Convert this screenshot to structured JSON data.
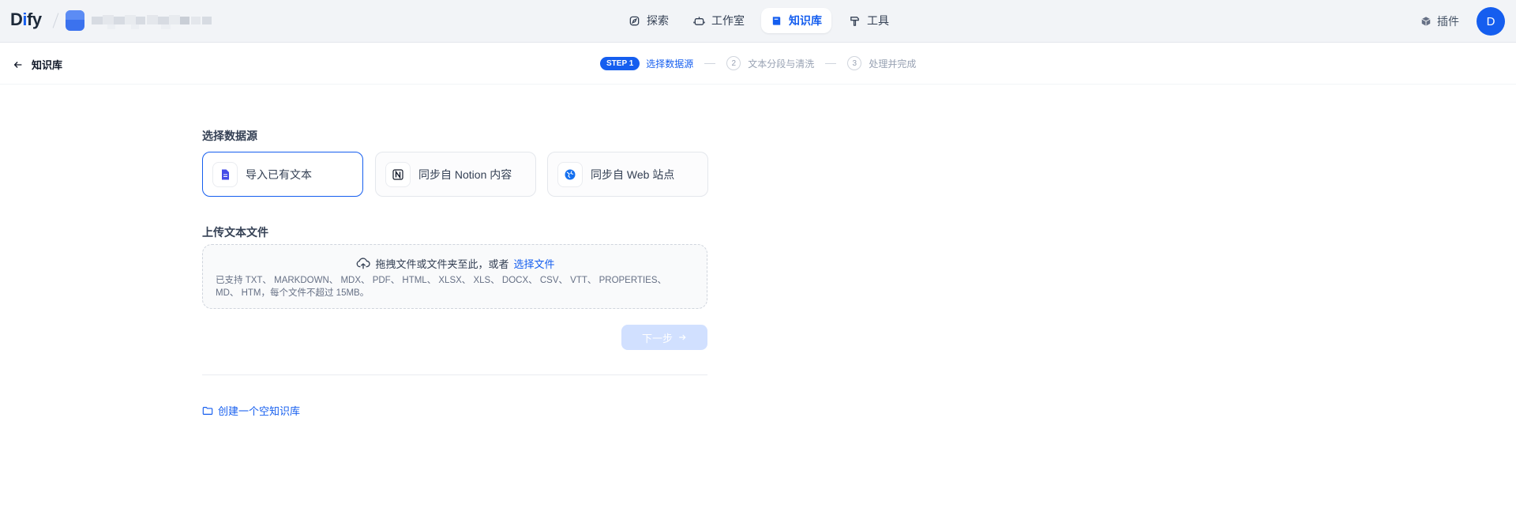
{
  "topbar": {
    "logo": {
      "part1": "D",
      "part2": "i",
      "part3": "fy"
    },
    "nav": [
      {
        "label": "探索",
        "icon": "compass-icon"
      },
      {
        "label": "工作室",
        "icon": "robot-icon"
      },
      {
        "label": "知识库",
        "icon": "book-icon",
        "active": true
      },
      {
        "label": "工具",
        "icon": "hammer-icon"
      }
    ],
    "plugin_label": "插件",
    "user_initial": "D"
  },
  "subheader": {
    "back_label": "知识库",
    "steps": [
      {
        "badge": "STEP 1",
        "label": "选择数据源"
      },
      {
        "num": "2",
        "label": "文本分段与清洗"
      },
      {
        "num": "3",
        "label": "处理并完成"
      }
    ]
  },
  "main": {
    "datasource_title": "选择数据源",
    "datasources": [
      {
        "label": "导入已有文本",
        "icon": "file-text-icon",
        "active": true
      },
      {
        "label": "同步自 Notion 内容",
        "icon": "notion-icon"
      },
      {
        "label": "同步自 Web 站点",
        "icon": "globe-icon"
      }
    ],
    "upload_title": "上传文本文件",
    "upload_text": "拖拽文件或文件夹至此，或者",
    "upload_link": "选择文件",
    "upload_hint": "已支持 TXT、 MARKDOWN、 MDX、 PDF、 HTML、 XLSX、 XLS、 DOCX、 CSV、 VTT、 PROPERTIES、 MD、 HTM，每个文件不超过 15MB。",
    "next_label": "下一步",
    "create_empty_label": "创建一个空知识库"
  },
  "colors": {
    "accent": "#155eef",
    "disabled_button": "#d1e0ff"
  }
}
